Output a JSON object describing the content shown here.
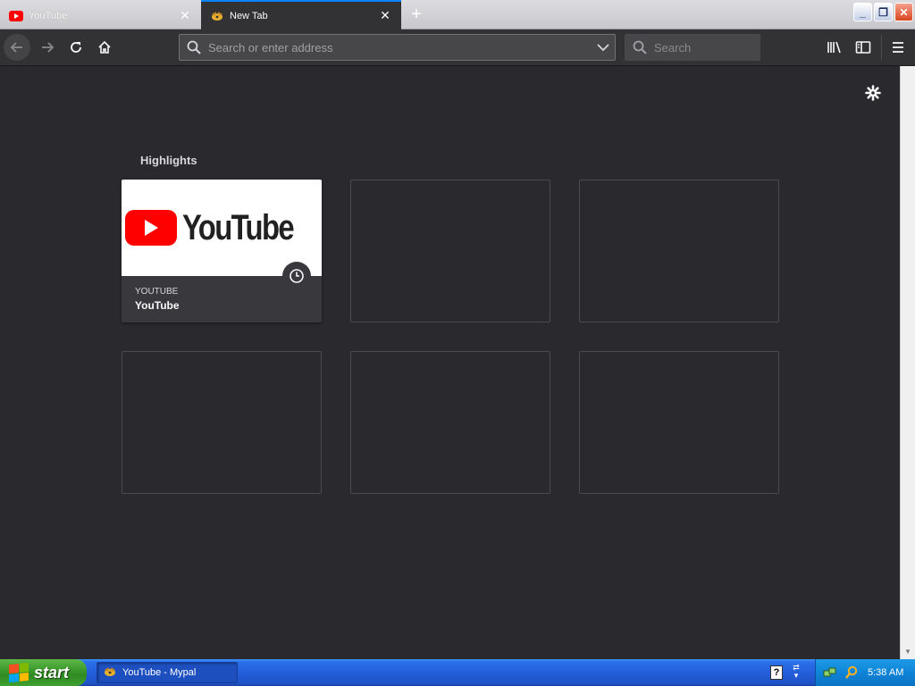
{
  "tabs": [
    {
      "title": "YouTube",
      "active": false
    },
    {
      "title": "New Tab",
      "active": true
    }
  ],
  "navbar": {
    "url_placeholder": "Search or enter address",
    "search_placeholder": "Search"
  },
  "content": {
    "section_title": "Highlights",
    "highlight_card": {
      "host": "YOUTUBE",
      "title": "YouTube",
      "logo_text": "YouTube"
    }
  },
  "taskbar": {
    "start_label": "start",
    "task_item": "YouTube - Mypal",
    "help_icon": "?",
    "clock": "5:38 AM"
  },
  "colors": {
    "content_bg": "#2a2a2e",
    "toolbar_bg": "#323234",
    "accent": "#0a84ff",
    "youtube_red": "#ff0000"
  }
}
